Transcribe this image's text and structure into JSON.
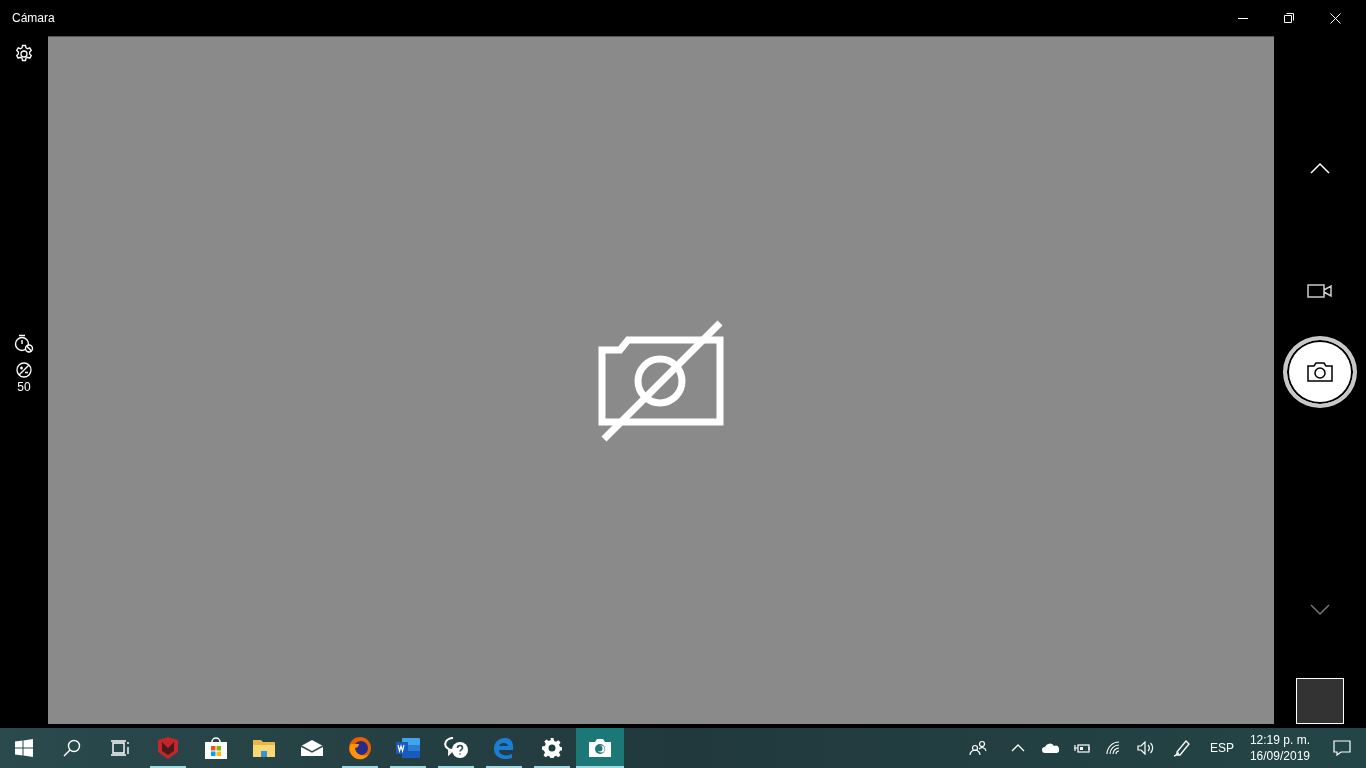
{
  "window": {
    "title": "Cámara"
  },
  "left_controls": {
    "exposure_value": "50"
  },
  "taskbar": {
    "apps": [
      {
        "kind": "start",
        "running": false,
        "selected": false
      },
      {
        "kind": "search",
        "running": false,
        "selected": false
      },
      {
        "kind": "taskview",
        "running": false,
        "selected": false
      },
      {
        "kind": "shield",
        "running": true,
        "selected": false
      },
      {
        "kind": "store",
        "running": false,
        "selected": false
      },
      {
        "kind": "folder",
        "running": false,
        "selected": false
      },
      {
        "kind": "mail",
        "running": false,
        "selected": false
      },
      {
        "kind": "browser-orange",
        "running": true,
        "selected": false
      },
      {
        "kind": "word",
        "running": true,
        "selected": false
      },
      {
        "kind": "help",
        "running": true,
        "selected": false
      },
      {
        "kind": "browser-blue",
        "running": true,
        "selected": false
      },
      {
        "kind": "settings",
        "running": true,
        "selected": false
      },
      {
        "kind": "camera",
        "running": true,
        "selected": true
      }
    ],
    "tray": {
      "language": "ESP",
      "time": "12:19 p. m.",
      "date": "16/09/2019"
    }
  }
}
